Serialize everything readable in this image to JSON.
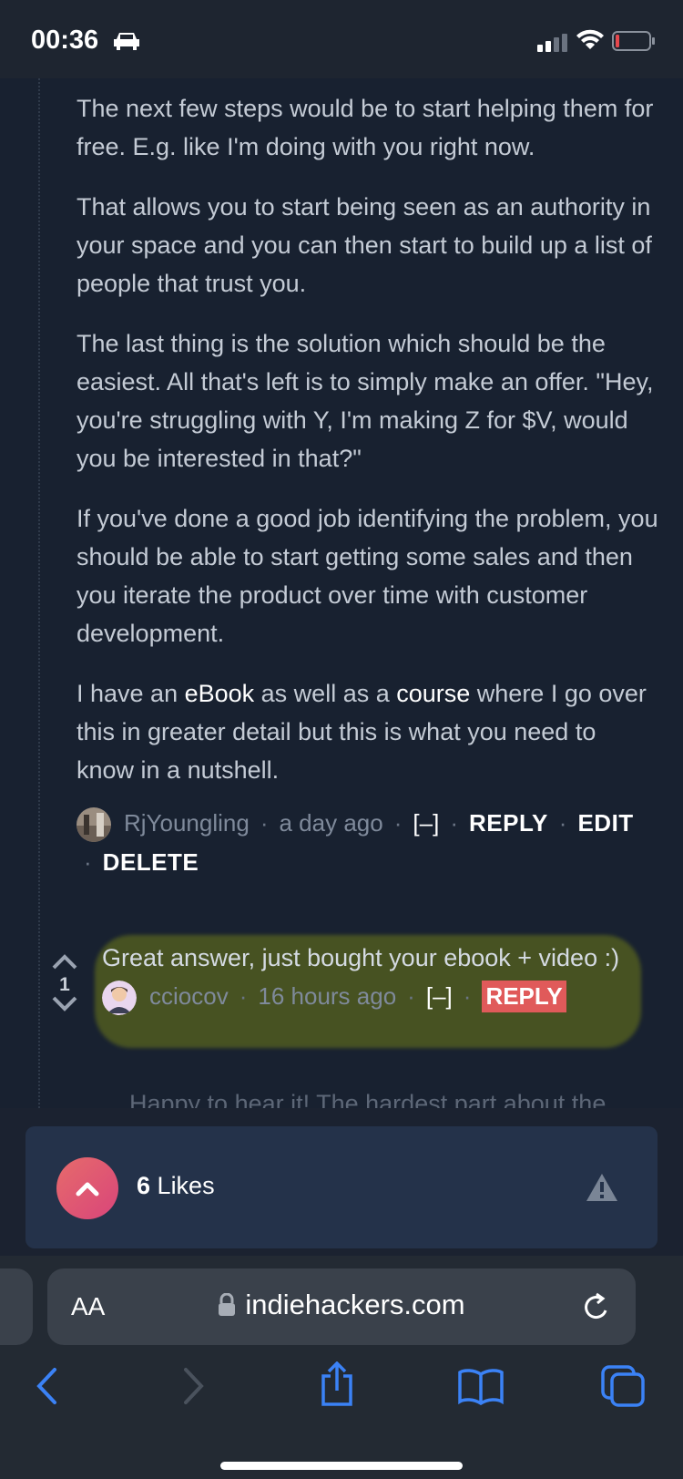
{
  "status": {
    "time": "00:36"
  },
  "comment1": {
    "paragraphs": [
      "The next few steps would be to start helping them for free. E.g. like I'm doing with you right now.",
      "That allows you to start being seen as an authority in your space and you can then start to build up a list of people that trust you.",
      "The last thing is the solution which should be the easiest. All that's left is to simply make an offer. \"Hey, you're struggling with Y, I'm making Z for $V, would you be interested in that?\"",
      "If you've done a good job identifying the problem, you should be able to start getting some sales and then you iterate the product over time with customer development."
    ],
    "last_para": {
      "prefix": "I have an ",
      "link1": "eBook",
      "mid": " as well as a ",
      "link2": "course",
      "suffix": " where I go over this in greater detail but this is what you need to know in a nutshell."
    },
    "author": "RjYoungling",
    "time": "a day ago",
    "collapse": "[–]",
    "reply": "REPLY",
    "edit": "EDIT",
    "delete": "DELETE"
  },
  "comment2": {
    "votes": "1",
    "text": "Great answer, just bought your ebook + video :)",
    "author": "cciocov",
    "time": "16 hours ago",
    "collapse": "[–]",
    "reply": "REPLY"
  },
  "comment3_preview": "Happy to hear it! The hardest part about the",
  "likes": {
    "count": "6",
    "label": "Likes"
  },
  "browser": {
    "aa_label": "AA",
    "url": "indiehackers.com"
  },
  "colors": {
    "background": "#182130",
    "likes_button": "#e0606e",
    "reply_highlight": "#e05a5a",
    "link": "#ffffff"
  }
}
